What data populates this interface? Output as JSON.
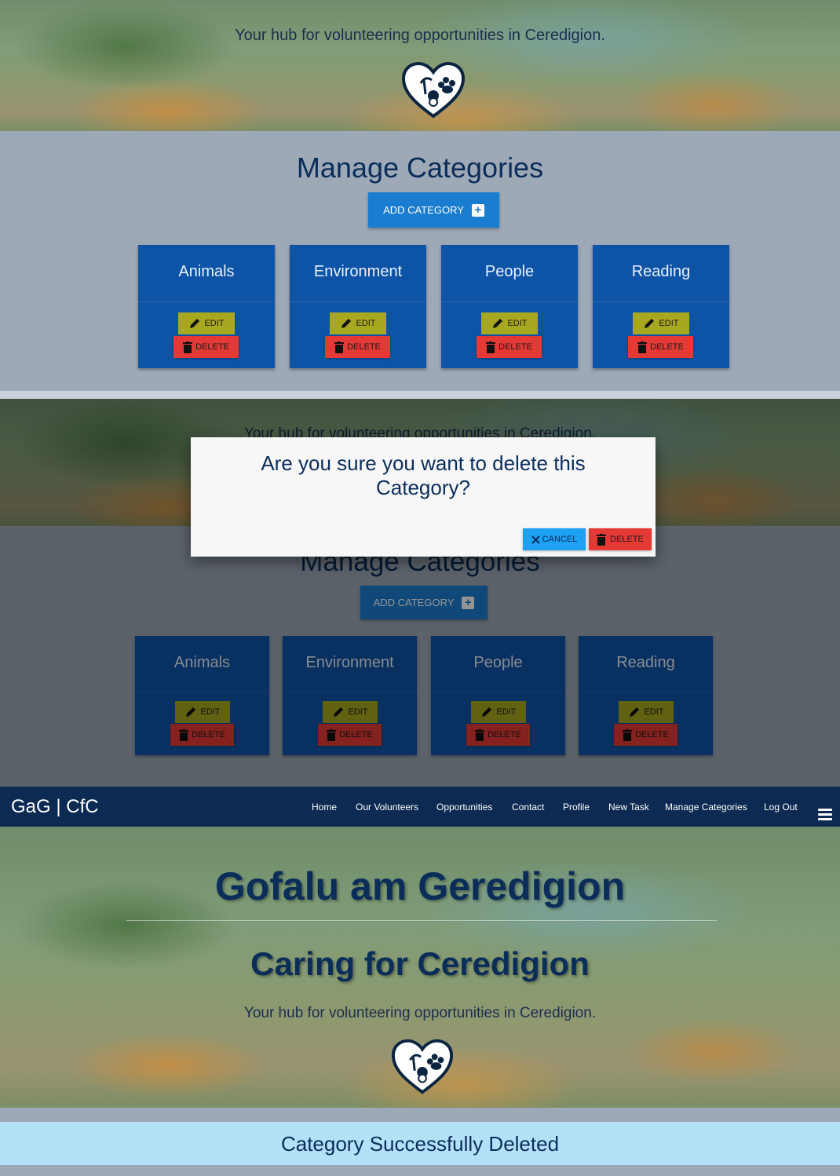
{
  "colors": {
    "navbar": "#0c2a52",
    "card": "#0e54a6",
    "add_button": "#1a7dd0",
    "edit_button": "#a8a820",
    "delete_button": "#e53935",
    "cancel_button": "#1da1f2",
    "alert": "#b3e1f7",
    "heading": "#0b2d5a"
  },
  "screen1": {
    "tagline": "Your hub for volunteering opportunities in Ceredigion.",
    "section_title": "Manage Categories",
    "add_button_label": "ADD CATEGORY",
    "add_button_icon": "plus-square-icon",
    "edit_label": "EDIT",
    "delete_label": "DELETE",
    "categories": [
      "Animals",
      "Environment",
      "People",
      "Reading"
    ]
  },
  "screen2": {
    "tagline": "Your hub for volunteering opportunities in Ceredigion.",
    "section_title": "Manage Categories",
    "add_button_label": "ADD CATEGORY",
    "edit_label": "EDIT",
    "delete_label": "DELETE",
    "categories": [
      "Animals",
      "Environment",
      "People",
      "Reading"
    ],
    "modal": {
      "message": "Are you sure you want to delete this Category?",
      "cancel_label": "CANCEL",
      "cancel_icon": "close-icon",
      "delete_label": "DELETE",
      "delete_icon": "trash-icon"
    }
  },
  "screen3": {
    "brand": "GaG | CfC",
    "nav": [
      "Home",
      "Our Volunteers",
      "Opportunities",
      "Contact",
      "Profile",
      "New Task",
      "Manage Categories",
      "Log Out"
    ],
    "title_welsh": "Gofalu am Geredigion",
    "title_english": "Caring for Ceredigion",
    "tagline": "Your hub for volunteering opportunities in Ceredigion.",
    "alert": "Category Successfully Deleted"
  }
}
